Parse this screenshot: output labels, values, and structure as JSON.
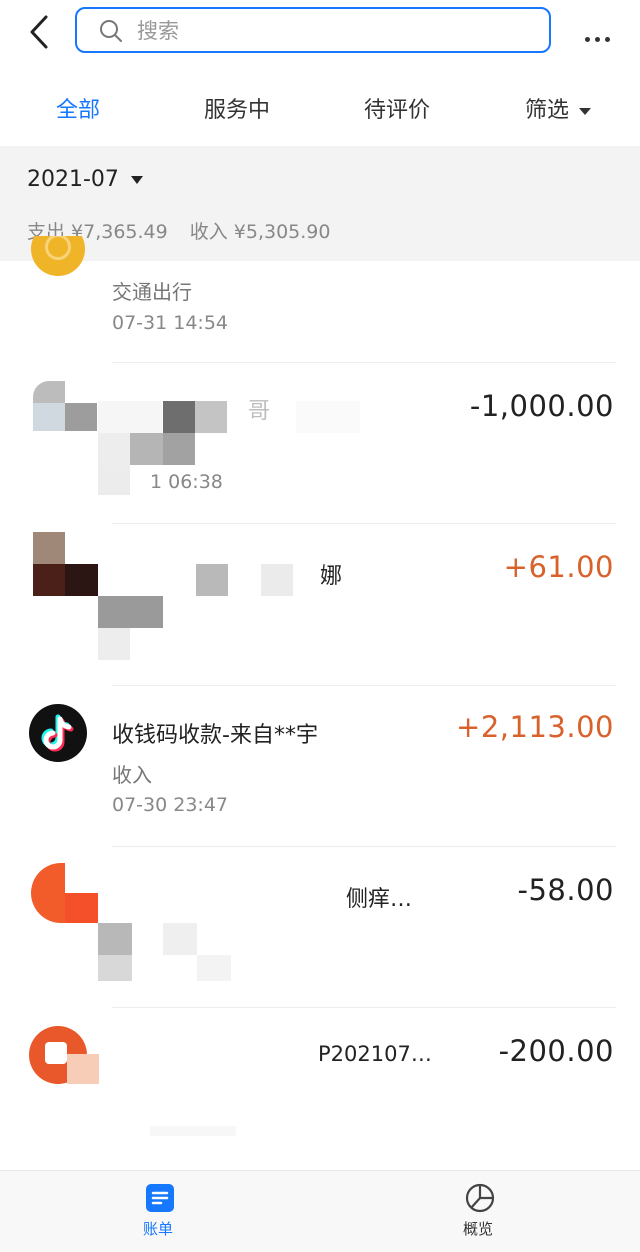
{
  "search": {
    "placeholder": "搜索"
  },
  "tabs": [
    {
      "label": "全部",
      "active": true
    },
    {
      "label": "服务中"
    },
    {
      "label": "待评价"
    },
    {
      "label": "筛选"
    }
  ],
  "summary": {
    "month": "2021-07",
    "expense": "支出 ¥7,365.49",
    "income": "收入 ¥5,305.90"
  },
  "transactions": [
    {
      "title": "",
      "category": "交通出行",
      "time": "07-31  14:54",
      "amount": ""
    },
    {
      "title": "哥",
      "category": "",
      "time": "1 06:38",
      "amount": "-1,000.00",
      "type": "out"
    },
    {
      "title": "娜",
      "category": "",
      "time": "",
      "amount": "+61.00",
      "type": "in"
    },
    {
      "title": "收钱码收款-来自**宇",
      "category": "收入",
      "time": "07-30  23:47",
      "amount": "+2,113.00",
      "type": "in"
    },
    {
      "title": "侧痒…",
      "category": "",
      "time": "",
      "amount": "-58.00",
      "type": "out"
    },
    {
      "title": "P202107…",
      "category": "",
      "time": "",
      "amount": "-200.00",
      "type": "out"
    }
  ],
  "bottom_nav": [
    {
      "label": "账单",
      "active": true
    },
    {
      "label": "概览"
    }
  ],
  "colors": {
    "accent": "#1677ff",
    "income": "#d8612c",
    "band": "#f3f3f3"
  }
}
